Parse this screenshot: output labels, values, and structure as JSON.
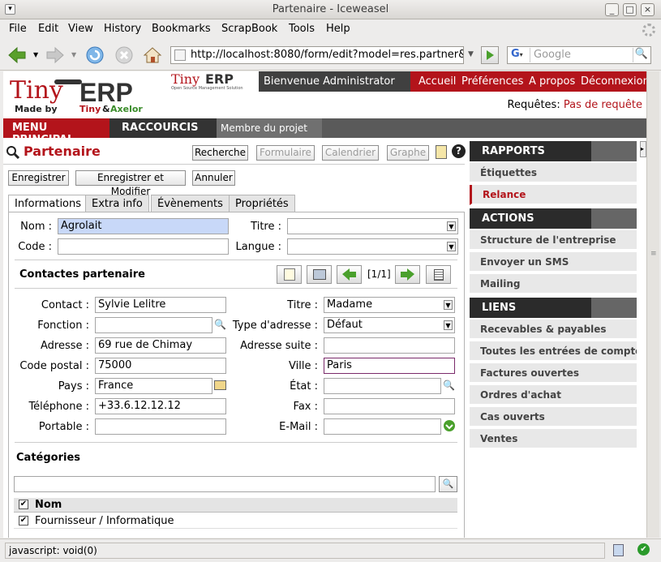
{
  "window": {
    "title": "Partenaire - Iceweasel"
  },
  "menubar": [
    "File",
    "Edit",
    "View",
    "History",
    "Bookmarks",
    "ScrapBook",
    "Tools",
    "Help"
  ],
  "nav": {
    "url": "http://localhost:8080/form/edit?model=res.partner&",
    "search_placeholder": "Google"
  },
  "header": {
    "logo_top": "Tiny",
    "logo_erp": "ERP",
    "logo_made_by": "Made by",
    "logo_tiny": "Tiny",
    "logo_and": "&",
    "logo_axelor": "Axelor",
    "small_logo": "Tiny",
    "small_logo_erp": "ERP",
    "small_logo_sub": "Open Source Management Solution",
    "welcome": "Bienvenue Administrator",
    "links": [
      "Accueil",
      "Préférences",
      "A propos",
      "Déconnexion"
    ],
    "requests_label": "Requêtes:",
    "requests_value": "Pas de requête"
  },
  "mainmenu": {
    "menu": "MENU PRINCIPAL",
    "shortcuts": "RACCOURCIS",
    "shortcut1": "Membre du projet"
  },
  "page": {
    "title": "Partenaire",
    "views": [
      "Recherche",
      "Formulaire",
      "Calendrier",
      "Graphe"
    ],
    "actions": [
      "Enregistrer",
      "Enregistrer et Modifier",
      "Annuler"
    ],
    "tabs": [
      "Informations",
      "Extra info",
      "Évènements",
      "Propriétés"
    ]
  },
  "form": {
    "nom_label": "Nom :",
    "nom_value": "Agrolait",
    "titre_label": "Titre :",
    "titre_value": "",
    "code_label": "Code :",
    "code_value": "",
    "langue_label": "Langue :",
    "langue_value": ""
  },
  "contacts": {
    "section": "Contactes partenaire",
    "pager": "[1/1]",
    "contact_label": "Contact :",
    "contact_value": "Sylvie Lelitre",
    "titre_label": "Titre :",
    "titre_value": "Madame",
    "fonction_label": "Fonction :",
    "fonction_value": "",
    "type_label": "Type d'adresse :",
    "type_value": "Défaut",
    "adresse_label": "Adresse :",
    "adresse_value": "69 rue de Chimay",
    "adresse_suite_label": "Adresse suite :",
    "adresse_suite_value": "",
    "cp_label": "Code postal :",
    "cp_value": "75000",
    "ville_label": "Ville :",
    "ville_value": "Paris",
    "pays_label": "Pays :",
    "pays_value": "France",
    "etat_label": "État :",
    "etat_value": "",
    "tel_label": "Téléphone :",
    "tel_value": "+33.6.12.12.12",
    "fax_label": "Fax :",
    "fax_value": "",
    "portable_label": "Portable :",
    "portable_value": "",
    "email_label": "E-Mail :",
    "email_value": ""
  },
  "categories": {
    "section": "Catégories",
    "search_value": "",
    "col_nom": "Nom",
    "rows": [
      "Fournisseur / Informatique"
    ]
  },
  "sidebar": {
    "rapports": "RAPPORTS",
    "rapports_items": [
      "Étiquettes",
      "Relance"
    ],
    "actions": "ACTIONS",
    "actions_items": [
      "Structure de l'entreprise",
      "Envoyer un SMS",
      "Mailing"
    ],
    "liens": "LIENS",
    "liens_items": [
      "Recevables & payables",
      "Toutes les entrées de compte",
      "Factures ouvertes",
      "Ordres d'achat",
      "Cas ouverts",
      "Ventes"
    ]
  },
  "status": {
    "text": "javascript: void(0)"
  }
}
